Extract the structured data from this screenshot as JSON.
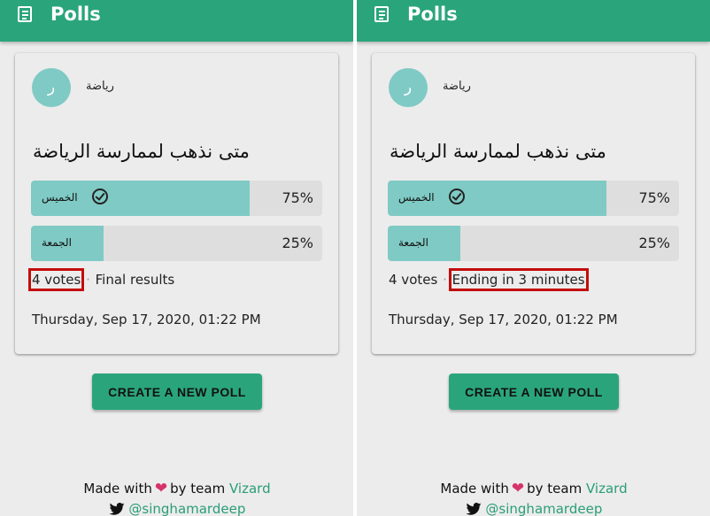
{
  "app": {
    "title": "Polls"
  },
  "panels": [
    {
      "author": {
        "avatar_letter": "ر",
        "name": "رياضة"
      },
      "question": "متى نذهب لممارسة الرياضة",
      "options": [
        {
          "label": "الخميس",
          "percent_text": "75%",
          "percent": 75,
          "selected": true
        },
        {
          "label": "الجمعة",
          "percent_text": "25%",
          "percent": 25,
          "selected": false
        }
      ],
      "votes": "4 votes",
      "separator": "·",
      "status": "Final results",
      "highlighted": "votes",
      "timestamp": "Thursday, Sep 17, 2020, 01:22 PM"
    },
    {
      "author": {
        "avatar_letter": "ر",
        "name": "رياضة"
      },
      "question": "متى نذهب لممارسة الرياضة",
      "options": [
        {
          "label": "الخميس",
          "percent_text": "75%",
          "percent": 75,
          "selected": true
        },
        {
          "label": "الجمعة",
          "percent_text": "25%",
          "percent": 25,
          "selected": false
        }
      ],
      "votes": "4 votes",
      "separator": "·",
      "status": "Ending in 3 minutes",
      "highlighted": "status",
      "timestamp": "Thursday, Sep 17, 2020, 01:22 PM"
    }
  ],
  "actions": {
    "create_label": "CREATE A NEW POLL"
  },
  "footer": {
    "made_with": "Made with",
    "heart": "❤",
    "by_team": "by team",
    "team_name": "Vizard",
    "twitter_handle": "@singhamardeep"
  },
  "colors": {
    "primary": "#2aa57b",
    "bar_fill": "#7fcac4",
    "bar_track": "#dedede",
    "highlight_box": "#c40c0c",
    "heart": "#d6336c"
  }
}
